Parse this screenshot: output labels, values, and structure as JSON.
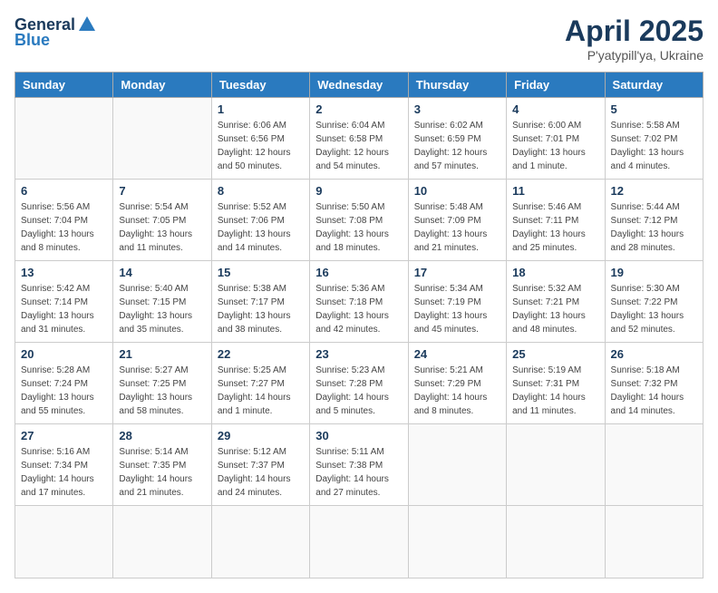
{
  "logo": {
    "general": "General",
    "blue": "Blue"
  },
  "header": {
    "month_year": "April 2025",
    "location": "P'yatypill'ya, Ukraine"
  },
  "weekdays": [
    "Sunday",
    "Monday",
    "Tuesday",
    "Wednesday",
    "Thursday",
    "Friday",
    "Saturday"
  ],
  "days": [
    {
      "date": "",
      "detail": ""
    },
    {
      "date": "",
      "detail": ""
    },
    {
      "date": "1",
      "detail": "Sunrise: 6:06 AM\nSunset: 6:56 PM\nDaylight: 12 hours\nand 50 minutes."
    },
    {
      "date": "2",
      "detail": "Sunrise: 6:04 AM\nSunset: 6:58 PM\nDaylight: 12 hours\nand 54 minutes."
    },
    {
      "date": "3",
      "detail": "Sunrise: 6:02 AM\nSunset: 6:59 PM\nDaylight: 12 hours\nand 57 minutes."
    },
    {
      "date": "4",
      "detail": "Sunrise: 6:00 AM\nSunset: 7:01 PM\nDaylight: 13 hours\nand 1 minute."
    },
    {
      "date": "5",
      "detail": "Sunrise: 5:58 AM\nSunset: 7:02 PM\nDaylight: 13 hours\nand 4 minutes."
    },
    {
      "date": "6",
      "detail": "Sunrise: 5:56 AM\nSunset: 7:04 PM\nDaylight: 13 hours\nand 8 minutes."
    },
    {
      "date": "7",
      "detail": "Sunrise: 5:54 AM\nSunset: 7:05 PM\nDaylight: 13 hours\nand 11 minutes."
    },
    {
      "date": "8",
      "detail": "Sunrise: 5:52 AM\nSunset: 7:06 PM\nDaylight: 13 hours\nand 14 minutes."
    },
    {
      "date": "9",
      "detail": "Sunrise: 5:50 AM\nSunset: 7:08 PM\nDaylight: 13 hours\nand 18 minutes."
    },
    {
      "date": "10",
      "detail": "Sunrise: 5:48 AM\nSunset: 7:09 PM\nDaylight: 13 hours\nand 21 minutes."
    },
    {
      "date": "11",
      "detail": "Sunrise: 5:46 AM\nSunset: 7:11 PM\nDaylight: 13 hours\nand 25 minutes."
    },
    {
      "date": "12",
      "detail": "Sunrise: 5:44 AM\nSunset: 7:12 PM\nDaylight: 13 hours\nand 28 minutes."
    },
    {
      "date": "13",
      "detail": "Sunrise: 5:42 AM\nSunset: 7:14 PM\nDaylight: 13 hours\nand 31 minutes."
    },
    {
      "date": "14",
      "detail": "Sunrise: 5:40 AM\nSunset: 7:15 PM\nDaylight: 13 hours\nand 35 minutes."
    },
    {
      "date": "15",
      "detail": "Sunrise: 5:38 AM\nSunset: 7:17 PM\nDaylight: 13 hours\nand 38 minutes."
    },
    {
      "date": "16",
      "detail": "Sunrise: 5:36 AM\nSunset: 7:18 PM\nDaylight: 13 hours\nand 42 minutes."
    },
    {
      "date": "17",
      "detail": "Sunrise: 5:34 AM\nSunset: 7:19 PM\nDaylight: 13 hours\nand 45 minutes."
    },
    {
      "date": "18",
      "detail": "Sunrise: 5:32 AM\nSunset: 7:21 PM\nDaylight: 13 hours\nand 48 minutes."
    },
    {
      "date": "19",
      "detail": "Sunrise: 5:30 AM\nSunset: 7:22 PM\nDaylight: 13 hours\nand 52 minutes."
    },
    {
      "date": "20",
      "detail": "Sunrise: 5:28 AM\nSunset: 7:24 PM\nDaylight: 13 hours\nand 55 minutes."
    },
    {
      "date": "21",
      "detail": "Sunrise: 5:27 AM\nSunset: 7:25 PM\nDaylight: 13 hours\nand 58 minutes."
    },
    {
      "date": "22",
      "detail": "Sunrise: 5:25 AM\nSunset: 7:27 PM\nDaylight: 14 hours\nand 1 minute."
    },
    {
      "date": "23",
      "detail": "Sunrise: 5:23 AM\nSunset: 7:28 PM\nDaylight: 14 hours\nand 5 minutes."
    },
    {
      "date": "24",
      "detail": "Sunrise: 5:21 AM\nSunset: 7:29 PM\nDaylight: 14 hours\nand 8 minutes."
    },
    {
      "date": "25",
      "detail": "Sunrise: 5:19 AM\nSunset: 7:31 PM\nDaylight: 14 hours\nand 11 minutes."
    },
    {
      "date": "26",
      "detail": "Sunrise: 5:18 AM\nSunset: 7:32 PM\nDaylight: 14 hours\nand 14 minutes."
    },
    {
      "date": "27",
      "detail": "Sunrise: 5:16 AM\nSunset: 7:34 PM\nDaylight: 14 hours\nand 17 minutes."
    },
    {
      "date": "28",
      "detail": "Sunrise: 5:14 AM\nSunset: 7:35 PM\nDaylight: 14 hours\nand 21 minutes."
    },
    {
      "date": "29",
      "detail": "Sunrise: 5:12 AM\nSunset: 7:37 PM\nDaylight: 14 hours\nand 24 minutes."
    },
    {
      "date": "30",
      "detail": "Sunrise: 5:11 AM\nSunset: 7:38 PM\nDaylight: 14 hours\nand 27 minutes."
    },
    {
      "date": "",
      "detail": ""
    },
    {
      "date": "",
      "detail": ""
    },
    {
      "date": "",
      "detail": ""
    },
    {
      "date": "",
      "detail": ""
    }
  ]
}
